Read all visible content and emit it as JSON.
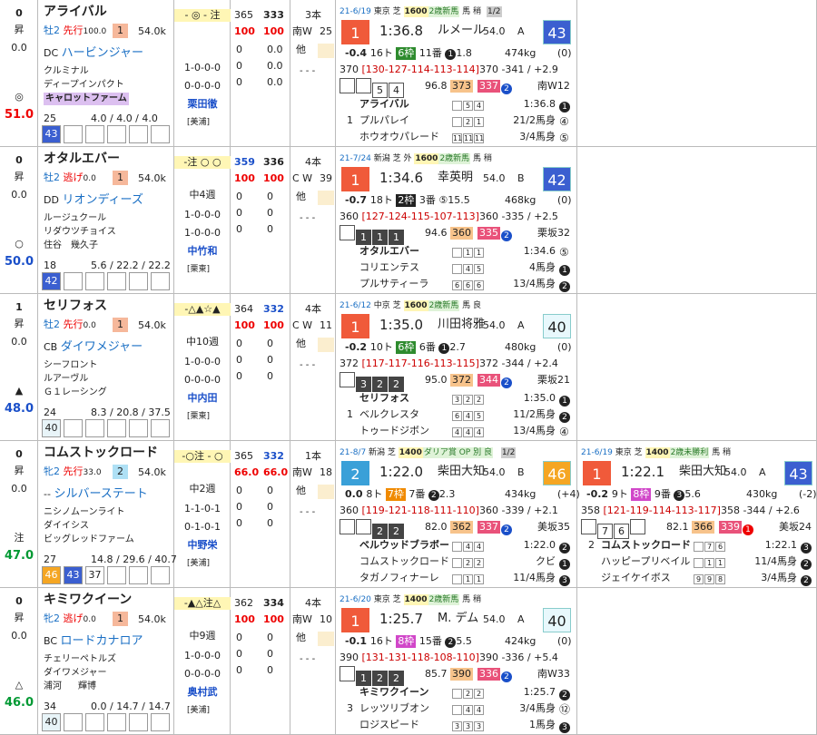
{
  "horses": [
    {
      "num": "0",
      "wave": "昇",
      "sub": "0.0",
      "mark": "◎",
      "score": "51.0",
      "score_color": "#e00",
      "name": "アライバル",
      "sex": "牡2",
      "style": "先行",
      "style_n": "100.0",
      "pop": "1",
      "weight": "54.0k",
      "sire_pre": "DC",
      "sire": "ハービンジャー",
      "dam": "クルミナル",
      "damsire": "ディープインパクト",
      "breeder": "キャロットファーム",
      "breeder_hl": true,
      "breeder_tag": "",
      "odds_a": "25",
      "odds_b": "4.0",
      "odds_c": "4.0",
      "odds_d": "4.0",
      "bbox": [
        "43",
        "",
        "",
        "",
        "",
        ""
      ],
      "bbox_col": [
        "#3b5fd0",
        "",
        "",
        "",
        "",
        ""
      ],
      "marks": "- ◎ - 注",
      "rest": "",
      "jockey_stat": [
        "1-0-0-0",
        "0-0-0-0"
      ],
      "jockey": "栗田徹",
      "stable": "[美浦]",
      "t1": "365",
      "t2": "333",
      "t3": "100",
      "t4": "100",
      "s_rows": [
        [
          "0",
          "0.0"
        ],
        [
          "0",
          "0.0"
        ],
        [
          "0",
          "0.0"
        ]
      ],
      "track": "3本",
      "wood": "南W",
      "wood_n": "25",
      "other": "他",
      "dash": "- - -",
      "races": [
        {
          "date": "21-6/19",
          "place": "東京 芝",
          "dist": "1600",
          "cls": "2歳新馬",
          "cond": "馬 稍",
          "note": "1/2",
          "rank": "1",
          "rank_bg": "#f05a3a",
          "time": "1:36.8",
          "jockey": "ルメール",
          "kg": "54.0",
          "grade": "A",
          "rating": "43",
          "rating_bg": "#3b5fd0",
          "rating_fg": "#fff",
          "diff": "-0.4",
          "heads": "16ト",
          "gate": "6枠",
          "gate_bg": "#2e8b2e",
          "order": "11番",
          "ord": "1",
          "odds": "1.8",
          "bw": "474kg",
          "bwc": "(0)",
          "laps": "370",
          "lap_seq": "[130-127-114-113-114]",
          "lap_tail": "370 -341 / +2.9",
          "hs": [
            "",
            "",
            "5",
            "4"
          ],
          "hsd": [
            false,
            false,
            false,
            false
          ],
          "idx": "96.8",
          "idx_a": "373",
          "idx_b": "337",
          "idx_n": "2",
          "track2": "南W12",
          "res": [
            {
              "pre": "",
              "name": "アライバル",
              "t": [
                "",
                "5",
                "4"
              ],
              "r": "1:36.8",
              "c": "1"
            },
            {
              "pre": "1",
              "name": "プルパレイ",
              "t": [
                "",
                "2",
                "1"
              ],
              "r": "21/2馬身",
              "c": "④"
            },
            {
              "pre": "",
              "name": "ホウオウパレード",
              "t": [
                "11",
                "11",
                "11"
              ],
              "r": "3/4馬身",
              "c": "⑤"
            }
          ]
        }
      ]
    },
    {
      "num": "0",
      "wave": "昇",
      "sub": "0.0",
      "mark": "○",
      "score": "50.0",
      "score_color": "#1a4fc9",
      "name": "オタルエバー",
      "sex": "牡2",
      "style": "逃げ",
      "style_n": "0.0",
      "pop": "1",
      "weight": "54.0k",
      "sire_pre": "DD",
      "sire": "リオンディーズ",
      "dam": "ルージュクール",
      "damsire": "リダウツチョイス",
      "breeder": "住谷　幾久子",
      "breeder_hl": false,
      "breeder_tag": "",
      "odds_a": "18",
      "odds_b": "5.6",
      "odds_c": "22.2",
      "odds_d": "22.2",
      "bbox": [
        "42",
        "",
        "",
        "",
        "",
        ""
      ],
      "bbox_col": [
        "#3b5fd0",
        "",
        "",
        "",
        "",
        ""
      ],
      "marks": "-注 ○ ○",
      "rest": "中4週",
      "jockey_stat": [
        "1-0-0-0",
        "1-0-0-0"
      ],
      "jockey": "中竹和",
      "stable": "[栗東]",
      "t1": "359",
      "t2": "336",
      "t3": "100",
      "t4": "100",
      "s_rows": [
        [
          "0",
          "0"
        ],
        [
          "0",
          "0"
        ],
        [
          "0",
          "0"
        ]
      ],
      "track": "4本",
      "wood": "C W",
      "wood_n": "39",
      "other": "他",
      "dash": "- - -",
      "races": [
        {
          "date": "21-7/24",
          "place": "新潟 芝 外",
          "dist": "1600",
          "cls": "2歳新馬",
          "cond": "馬 稍",
          "note": "",
          "rank": "1",
          "rank_bg": "#f05a3a",
          "time": "1:34.6",
          "jockey": "幸英明",
          "kg": "54.0",
          "grade": "B",
          "rating": "42",
          "rating_bg": "#3b5fd0",
          "rating_fg": "#fff",
          "diff": "-0.7",
          "heads": "18ト",
          "gate": "2枠",
          "gate_bg": "#222",
          "order": "3番",
          "ord": "⑤",
          "odds": "15.5",
          "bw": "468kg",
          "bwc": "(0)",
          "laps": "360",
          "lap_seq": "[127-124-115-107-113]",
          "lap_tail": "360 -335 / +2.5",
          "hs": [
            "",
            "1",
            "1",
            "1"
          ],
          "hsd": [
            false,
            true,
            true,
            true
          ],
          "idx": "94.6",
          "idx_a": "360",
          "idx_b": "335",
          "idx_n": "2",
          "track2": "栗坂32",
          "res": [
            {
              "pre": "",
              "name": "オタルエバー",
              "t": [
                "",
                "1",
                "1"
              ],
              "r": "1:34.6",
              "c": "⑤"
            },
            {
              "pre": "",
              "name": "コリエンテス",
              "t": [
                "",
                "4",
                "5"
              ],
              "r": "4馬身",
              "c": "1"
            },
            {
              "pre": "",
              "name": "プルサティーラ",
              "t": [
                "6",
                "6",
                "6"
              ],
              "r": "13/4馬身",
              "c": "2"
            }
          ]
        }
      ]
    },
    {
      "num": "1",
      "wave": "昇",
      "sub": "0.0",
      "mark": "▲",
      "score": "48.0",
      "score_color": "#1a4fc9",
      "name": "セリフォス",
      "sex": "牡2",
      "style": "先行",
      "style_n": "0.0",
      "pop": "1",
      "weight": "54.0k",
      "sire_pre": "CB",
      "sire": "ダイワメジャー",
      "dam": "シーフロント",
      "damsire": "ルアーヴル",
      "breeder": "Ｇ１レーシング",
      "breeder_hl": false,
      "breeder_tag": "",
      "odds_a": "24",
      "odds_b": "8.3",
      "odds_c": "20.8",
      "odds_d": "37.5",
      "bbox": [
        "40",
        "",
        "",
        "",
        "",
        ""
      ],
      "bbox_col": [
        "#e8f4f8",
        "",
        "",
        "",
        "",
        ""
      ],
      "marks": "-△▲☆▲",
      "rest": "中10週",
      "jockey_stat": [
        "1-0-0-0",
        "0-0-0-0"
      ],
      "jockey": "中内田",
      "stable": "[栗東]",
      "t1": "364",
      "t2": "332",
      "t3": "100",
      "t4": "100",
      "s_rows": [
        [
          "0",
          "0"
        ],
        [
          "0",
          "0"
        ],
        [
          "0",
          "0"
        ]
      ],
      "track": "4本",
      "wood": "C W",
      "wood_n": "11",
      "other": "他",
      "dash": "- - -",
      "races": [
        {
          "date": "21-6/12",
          "place": "中京 芝",
          "dist": "1600",
          "cls": "2歳新馬",
          "cond": "馬 良",
          "note": "",
          "rank": "1",
          "rank_bg": "#f05a3a",
          "time": "1:35.0",
          "jockey": "川田将雅",
          "kg": "54.0",
          "grade": "A",
          "rating": "40",
          "rating_bg": "#e8f8fc",
          "rating_fg": "#222",
          "diff": "-0.2",
          "heads": "10ト",
          "gate": "6枠",
          "gate_bg": "#2e8b2e",
          "order": "6番",
          "ord": "1",
          "odds": "2.7",
          "bw": "480kg",
          "bwc": "(0)",
          "laps": "372",
          "lap_seq": "[117-117-116-113-115]",
          "lap_tail": "372 -344 / +2.4",
          "hs": [
            "",
            "3",
            "2",
            "2"
          ],
          "hsd": [
            false,
            true,
            true,
            true
          ],
          "idx": "95.0",
          "idx_a": "372",
          "idx_b": "344",
          "idx_n": "2",
          "track2": "栗坂21",
          "res": [
            {
              "pre": "",
              "name": "セリフォス",
              "t": [
                "3",
                "2",
                "2"
              ],
              "r": "1:35.0",
              "c": "1"
            },
            {
              "pre": "1",
              "name": "ベルクレスタ",
              "t": [
                "6",
                "4",
                "5"
              ],
              "r": "11/2馬身",
              "c": "2"
            },
            {
              "pre": "",
              "name": "トゥードジボン",
              "t": [
                "4",
                "4",
                "4"
              ],
              "r": "13/4馬身",
              "c": "④"
            }
          ]
        }
      ]
    },
    {
      "num": "0",
      "wave": "昇",
      "sub": "0.0",
      "mark": "注",
      "score": "47.0",
      "score_color": "#093",
      "name": "コムストックロード",
      "sex": "牝2",
      "style": "先行",
      "style_n": "33.0",
      "pop": "2",
      "weight": "54.0k",
      "sire_pre": "--",
      "sire": "シルバーステート",
      "dam": "ニシノムーンライト",
      "damsire": "ダイイシス",
      "breeder": "ビッグレッドファーム",
      "breeder_hl": false,
      "breeder_tag": "",
      "odds_a": "27",
      "odds_b": "14.8",
      "odds_c": "29.6",
      "odds_d": "40.7",
      "bbox": [
        "46",
        "43",
        "37",
        "",
        "",
        ""
      ],
      "bbox_col": [
        "#f5a623",
        "#3b5fd0",
        "#fff",
        "",
        "",
        ""
      ],
      "marks": "-○注 - ○",
      "rest": "中2週",
      "jockey_stat": [
        "1-1-0-1",
        "0-1-0-1"
      ],
      "jockey": "中野栄",
      "stable": "[美浦]",
      "t1": "365",
      "t2": "332",
      "t3": "66.0",
      "t4": "66.0",
      "s_rows": [
        [
          "0",
          "0"
        ],
        [
          "0",
          "0"
        ],
        [
          "0",
          "0"
        ]
      ],
      "track": "1本",
      "wood": "南W",
      "wood_n": "18",
      "other": "他",
      "dash": "- - -",
      "races": [
        {
          "date": "21-8/7",
          "place": "新潟 芝",
          "dist": "1400",
          "cls": "ダリア賞 OP 別 良",
          "cond": "",
          "note": "1/2",
          "rank": "2",
          "rank_bg": "#3aa0d8",
          "time": "1:22.0",
          "jockey": "柴田大知",
          "kg": "54.0",
          "grade": "B",
          "rating": "46",
          "rating_bg": "#f5a623",
          "rating_fg": "#fff",
          "diff": "0.0",
          "heads": "8ト",
          "gate": "7枠",
          "gate_bg": "#f08a00",
          "order": "7番",
          "ord": "2",
          "odds": "2.3",
          "bw": "434kg",
          "bwc": "(+4)",
          "laps": "360",
          "lap_seq": "[119-121-118-111-110]",
          "lap_tail": "360 -339 / +2.1",
          "hs": [
            "",
            "",
            "2",
            "2"
          ],
          "hsd": [
            false,
            false,
            true,
            true
          ],
          "idx": "82.0",
          "idx_a": "362",
          "idx_b": "337",
          "idx_n": "2",
          "track2": "美坂35",
          "res": [
            {
              "pre": "",
              "name": "ベルウッドブラボー",
              "t": [
                "",
                "4",
                "4"
              ],
              "r": "1:22.0",
              "c": "2"
            },
            {
              "pre": "",
              "name": "コムストックロード",
              "t": [
                "",
                "2",
                "2"
              ],
              "r": "クビ",
              "c": "1"
            },
            {
              "pre": "",
              "name": "タガノフィナーレ",
              "t": [
                "",
                "1",
                "1"
              ],
              "r": "11/4馬身",
              "c": "3"
            }
          ]
        },
        {
          "date": "21-6/19",
          "place": "東京 芝",
          "dist": "1400",
          "cls": "2歳未勝利",
          "cond": "馬 稍",
          "note": "",
          "rank": "1",
          "rank_bg": "#f05a3a",
          "time": "1:22.1",
          "jockey": "柴田大知",
          "kg": "54.0",
          "grade": "A",
          "rating": "43",
          "rating_bg": "#3b5fd0",
          "rating_fg": "#fff",
          "diff": "-0.2",
          "heads": "9ト",
          "gate": "8枠",
          "gate_bg": "#d147c9",
          "order": "9番",
          "ord": "3",
          "odds": "5.6",
          "bw": "430kg",
          "bwc": "(-2)",
          "laps": "358",
          "lap_seq": "[121-119-114-113-117]",
          "lap_tail": "358 -344 / +2.6",
          "hs": [
            "",
            "7",
            "6",
            ""
          ],
          "hsd": [
            false,
            false,
            false,
            false
          ],
          "idx": "82.1",
          "idx_a": "366",
          "idx_b": "339",
          "idx_n": "1",
          "track2": "美坂24",
          "res": [
            {
              "pre": "2",
              "name": "コムストックロード",
              "t": [
                "",
                "7",
                "6"
              ],
              "r": "1:22.1",
              "c": "3"
            },
            {
              "pre": "",
              "name": "ハッピープリベイル",
              "t": [
                "",
                "1",
                "1"
              ],
              "r": "11/4馬身",
              "c": "2"
            },
            {
              "pre": "",
              "name": "ジェイケイボス",
              "t": [
                "9",
                "9",
                "8"
              ],
              "r": "3/4馬身",
              "c": "2"
            }
          ]
        }
      ]
    },
    {
      "num": "0",
      "wave": "昇",
      "sub": "0.0",
      "mark": "△",
      "score": "46.0",
      "score_color": "#093",
      "name": "キミワクイーン",
      "sex": "牝2",
      "style": "逃げ",
      "style_n": "0.0",
      "pop": "1",
      "weight": "54.0k",
      "sire_pre": "BC",
      "sire": "ロードカナロア",
      "dam": "チェリーペトルズ",
      "damsire": "ダイワメジャー",
      "breeder": "浦河",
      "breeder_hl": false,
      "breeder_tag": "輝博",
      "odds_a": "34",
      "odds_b": "0.0",
      "odds_c": "14.7",
      "odds_d": "14.7",
      "bbox": [
        "40",
        "",
        "",
        "",
        "",
        ""
      ],
      "bbox_col": [
        "#e8f4f8",
        "",
        "",
        "",
        "",
        ""
      ],
      "marks": "-▲△注△",
      "rest": "中9週",
      "jockey_stat": [
        "1-0-0-0",
        "0-0-0-0"
      ],
      "jockey": "奥村武",
      "stable": "[美浦]",
      "t1": "362",
      "t2": "334",
      "t3": "100",
      "t4": "100",
      "s_rows": [
        [
          "0",
          "0"
        ],
        [
          "0",
          "0"
        ],
        [
          "0",
          "0"
        ]
      ],
      "track": "4本",
      "wood": "南W",
      "wood_n": "10",
      "other": "他",
      "dash": "- - -",
      "races": [
        {
          "date": "21-6/20",
          "place": "東京 芝",
          "dist": "1400",
          "cls": "2歳新馬",
          "cond": "馬 稍",
          "note": "",
          "rank": "1",
          "rank_bg": "#f05a3a",
          "time": "1:25.7",
          "jockey": "M. デム",
          "kg": "54.0",
          "grade": "A",
          "rating": "40",
          "rating_bg": "#e8f8fc",
          "rating_fg": "#222",
          "diff": "-0.1",
          "heads": "16ト",
          "gate": "8枠",
          "gate_bg": "#d147c9",
          "order": "15番",
          "ord": "2",
          "odds": "5.5",
          "bw": "424kg",
          "bwc": "(0)",
          "laps": "390",
          "lap_seq": "[131-131-118-108-110]",
          "lap_tail": "390 -336 / +5.4",
          "hs": [
            "",
            "1",
            "2",
            "2"
          ],
          "hsd": [
            false,
            true,
            true,
            true
          ],
          "idx": "85.7",
          "idx_a": "390",
          "idx_b": "336",
          "idx_n": "2",
          "track2": "南W33",
          "res": [
            {
              "pre": "",
              "name": "キミワクイーン",
              "t": [
                "",
                "2",
                "2"
              ],
              "r": "1:25.7",
              "c": "2"
            },
            {
              "pre": "3",
              "name": "レッツリブオン",
              "t": [
                "",
                "4",
                "4"
              ],
              "r": "3/4馬身",
              "c": "⑫"
            },
            {
              "pre": "",
              "name": "ロジスピード",
              "t": [
                "3",
                "3",
                "3"
              ],
              "r": "1馬身",
              "c": "3"
            }
          ]
        }
      ]
    }
  ]
}
